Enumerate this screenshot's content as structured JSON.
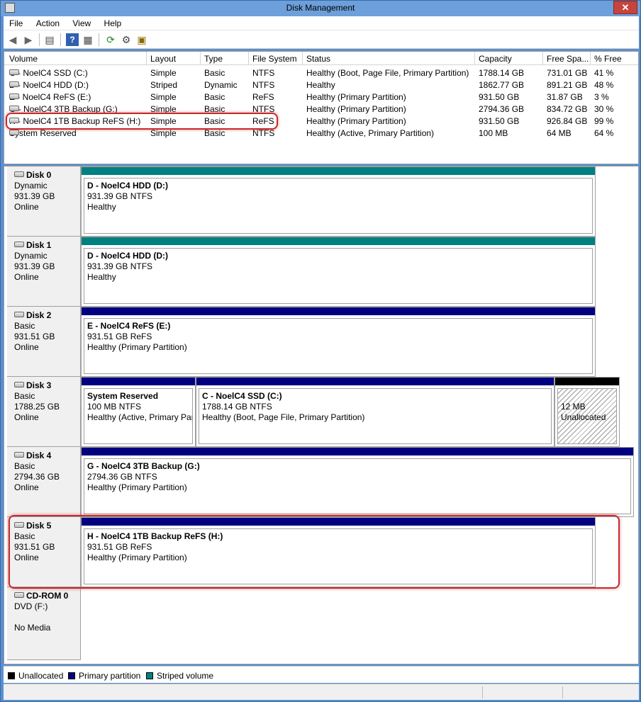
{
  "window": {
    "title": "Disk Management",
    "close_label": "✕"
  },
  "menu": [
    "File",
    "Action",
    "View",
    "Help"
  ],
  "toolbar": {
    "icons": [
      "back-arrow-icon",
      "forward-arrow-icon",
      "console-tree-icon",
      "help-icon",
      "properties-icon",
      "refresh-icon",
      "settings-icon",
      "export-icon"
    ]
  },
  "volume_list": {
    "columns": [
      "Volume",
      "Layout",
      "Type",
      "File System",
      "Status",
      "Capacity",
      "Free Spa...",
      "% Free"
    ],
    "rows": [
      {
        "volume": "C - NoelC4 SSD (C:)",
        "layout": "Simple",
        "type": "Basic",
        "fs": "NTFS",
        "status": "Healthy (Boot, Page File, Primary Partition)",
        "capacity": "1788.14 GB",
        "free": "731.01 GB",
        "pct": "41 %"
      },
      {
        "volume": "D - NoelC4 HDD (D:)",
        "layout": "Striped",
        "type": "Dynamic",
        "fs": "NTFS",
        "status": "Healthy",
        "capacity": "1862.77 GB",
        "free": "891.21 GB",
        "pct": "48 %"
      },
      {
        "volume": "E - NoelC4 ReFS (E:)",
        "layout": "Simple",
        "type": "Basic",
        "fs": "ReFS",
        "status": "Healthy (Primary Partition)",
        "capacity": "931.50 GB",
        "free": "31.87 GB",
        "pct": "3 %"
      },
      {
        "volume": "G - NoelC4 3TB Backup (G:)",
        "layout": "Simple",
        "type": "Basic",
        "fs": "NTFS",
        "status": "Healthy (Primary Partition)",
        "capacity": "2794.36 GB",
        "free": "834.72 GB",
        "pct": "30 %"
      },
      {
        "volume": "H - NoelC4 1TB Backup ReFS (H:)",
        "layout": "Simple",
        "type": "Basic",
        "fs": "ReFS",
        "status": "Healthy (Primary Partition)",
        "capacity": "931.50 GB",
        "free": "926.84 GB",
        "pct": "99 %"
      },
      {
        "volume": "System Reserved",
        "layout": "Simple",
        "type": "Basic",
        "fs": "NTFS",
        "status": "Healthy (Active, Primary Partition)",
        "capacity": "100 MB",
        "free": "64 MB",
        "pct": "64 %"
      }
    ]
  },
  "disks": [
    {
      "name": "Disk 0",
      "kind": "Dynamic",
      "size": "931.39 GB",
      "state": "Online",
      "partitions": [
        {
          "title": "D - NoelC4 HDD  (D:)",
          "line2": "931.39 GB NTFS",
          "line3": "Healthy",
          "color": "#008080"
        }
      ]
    },
    {
      "name": "Disk 1",
      "kind": "Dynamic",
      "size": "931.39 GB",
      "state": "Online",
      "partitions": [
        {
          "title": "D - NoelC4 HDD  (D:)",
          "line2": "931.39 GB NTFS",
          "line3": "Healthy",
          "color": "#008080"
        }
      ]
    },
    {
      "name": "Disk 2",
      "kind": "Basic",
      "size": "931.51 GB",
      "state": "Online",
      "partitions": [
        {
          "title": "E - NoelC4 ReFS  (E:)",
          "line2": "931.51 GB ReFS",
          "line3": "Healthy (Primary Partition)",
          "color": "#000080"
        }
      ]
    },
    {
      "name": "Disk 3",
      "kind": "Basic",
      "size": "1788.25 GB",
      "state": "Online",
      "partitions": [
        {
          "title": "System Reserved",
          "line2": "100 MB NTFS",
          "line3": "Healthy (Active, Primary Partition)",
          "color": "#000080"
        },
        {
          "title": "C - NoelC4 SSD  (C:)",
          "line2": "1788.14 GB NTFS",
          "line3": "Healthy (Boot, Page File, Primary Partition)",
          "color": "#000080"
        },
        {
          "title": "",
          "line2": "12 MB",
          "line3": "Unallocated",
          "color": "#000000"
        }
      ]
    },
    {
      "name": "Disk 4",
      "kind": "Basic",
      "size": "2794.36 GB",
      "state": "Online",
      "partitions": [
        {
          "title": "G - NoelC4 3TB Backup  (G:)",
          "line2": "2794.36 GB NTFS",
          "line3": "Healthy (Primary Partition)",
          "color": "#000080"
        }
      ]
    },
    {
      "name": "Disk 5",
      "kind": "Basic",
      "size": "931.51 GB",
      "state": "Online",
      "partitions": [
        {
          "title": "H - NoelC4 1TB Backup ReFS  (H:)",
          "line2": "931.51 GB ReFS",
          "line3": "Healthy (Primary Partition)",
          "color": "#000080"
        }
      ]
    },
    {
      "name": "CD-ROM 0",
      "kind": "DVD (F:)",
      "size": "",
      "state": "No Media",
      "partitions": []
    }
  ],
  "legend": [
    "Unallocated",
    "Primary partition",
    "Striped volume"
  ],
  "colors": {
    "primary": "#000080",
    "striped": "#008080",
    "unallocated": "#000000",
    "highlight": "#c8282c"
  }
}
